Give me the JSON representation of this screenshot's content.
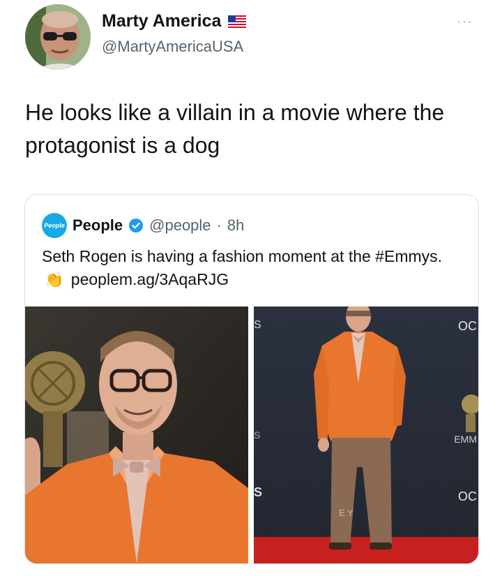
{
  "tweet": {
    "author_name": "Marty America",
    "author_flag": "us-flag-icon",
    "author_handle": "@MartyAmericaUSA",
    "more": "···",
    "text": "He looks like a villain in a movie where the protagonist is a dog"
  },
  "quoted": {
    "logo_text": "People",
    "name": "People",
    "verified": "verified-badge-icon",
    "handle": "@people",
    "separator": "·",
    "time": "8h",
    "text_part1": "Seth Rogen is having a fashion moment at the #Emmys.",
    "emoji": "👏",
    "link": "peoplem.ag/3AqaRJG",
    "photo2_overlays": {
      "top_right": "OC",
      "mid_right": "EMM",
      "bottom_right": "OC",
      "left_top": "S",
      "left_mid": "S",
      "left_bottom": "S",
      "bottom_text": "E  Y"
    }
  },
  "colors": {
    "accent": "#1d9bf0",
    "orange_jacket": "#e8762f",
    "red_carpet": "#c81f1f"
  }
}
